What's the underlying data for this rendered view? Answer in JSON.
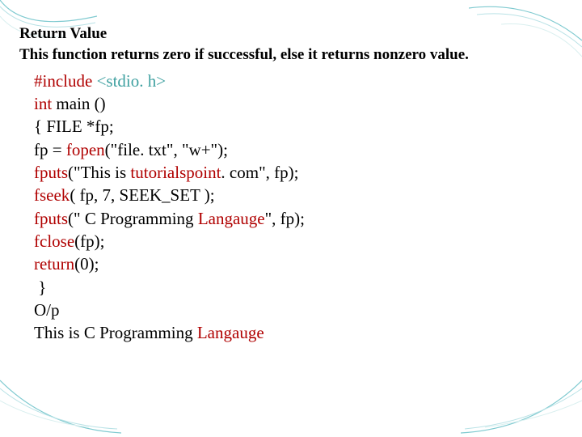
{
  "heading": "Return Value",
  "desc": "This function returns zero if successful, else it returns nonzero value.",
  "code": {
    "l1a": "#include ",
    "l1b": "<stdio. h>",
    "l2a": "int",
    "l2b": " main ()",
    "l3": "{ FILE *fp;",
    "l4a": "fp = ",
    "l4b": "fopen",
    "l4c": "(\"file. txt\", \"w+\");",
    "l5a": "fputs",
    "l5b": "(\"This is ",
    "l5c": "tutorialspoint",
    "l5d": ". com\", fp);",
    "l6a": "fseek",
    "l6b": "( fp, 7, SEEK_SET );",
    "l7a": "fputs",
    "l7b": "(\" C Programming ",
    "l7c": "Langauge",
    "l7d": "\", fp);",
    "l8a": "fclose",
    "l8b": "(fp);",
    "l9a": "return",
    "l9b": "(0);",
    "l10": " }",
    "l11": "O/p",
    "l12a": "This is C Programming ",
    "l12b": "Langauge"
  }
}
